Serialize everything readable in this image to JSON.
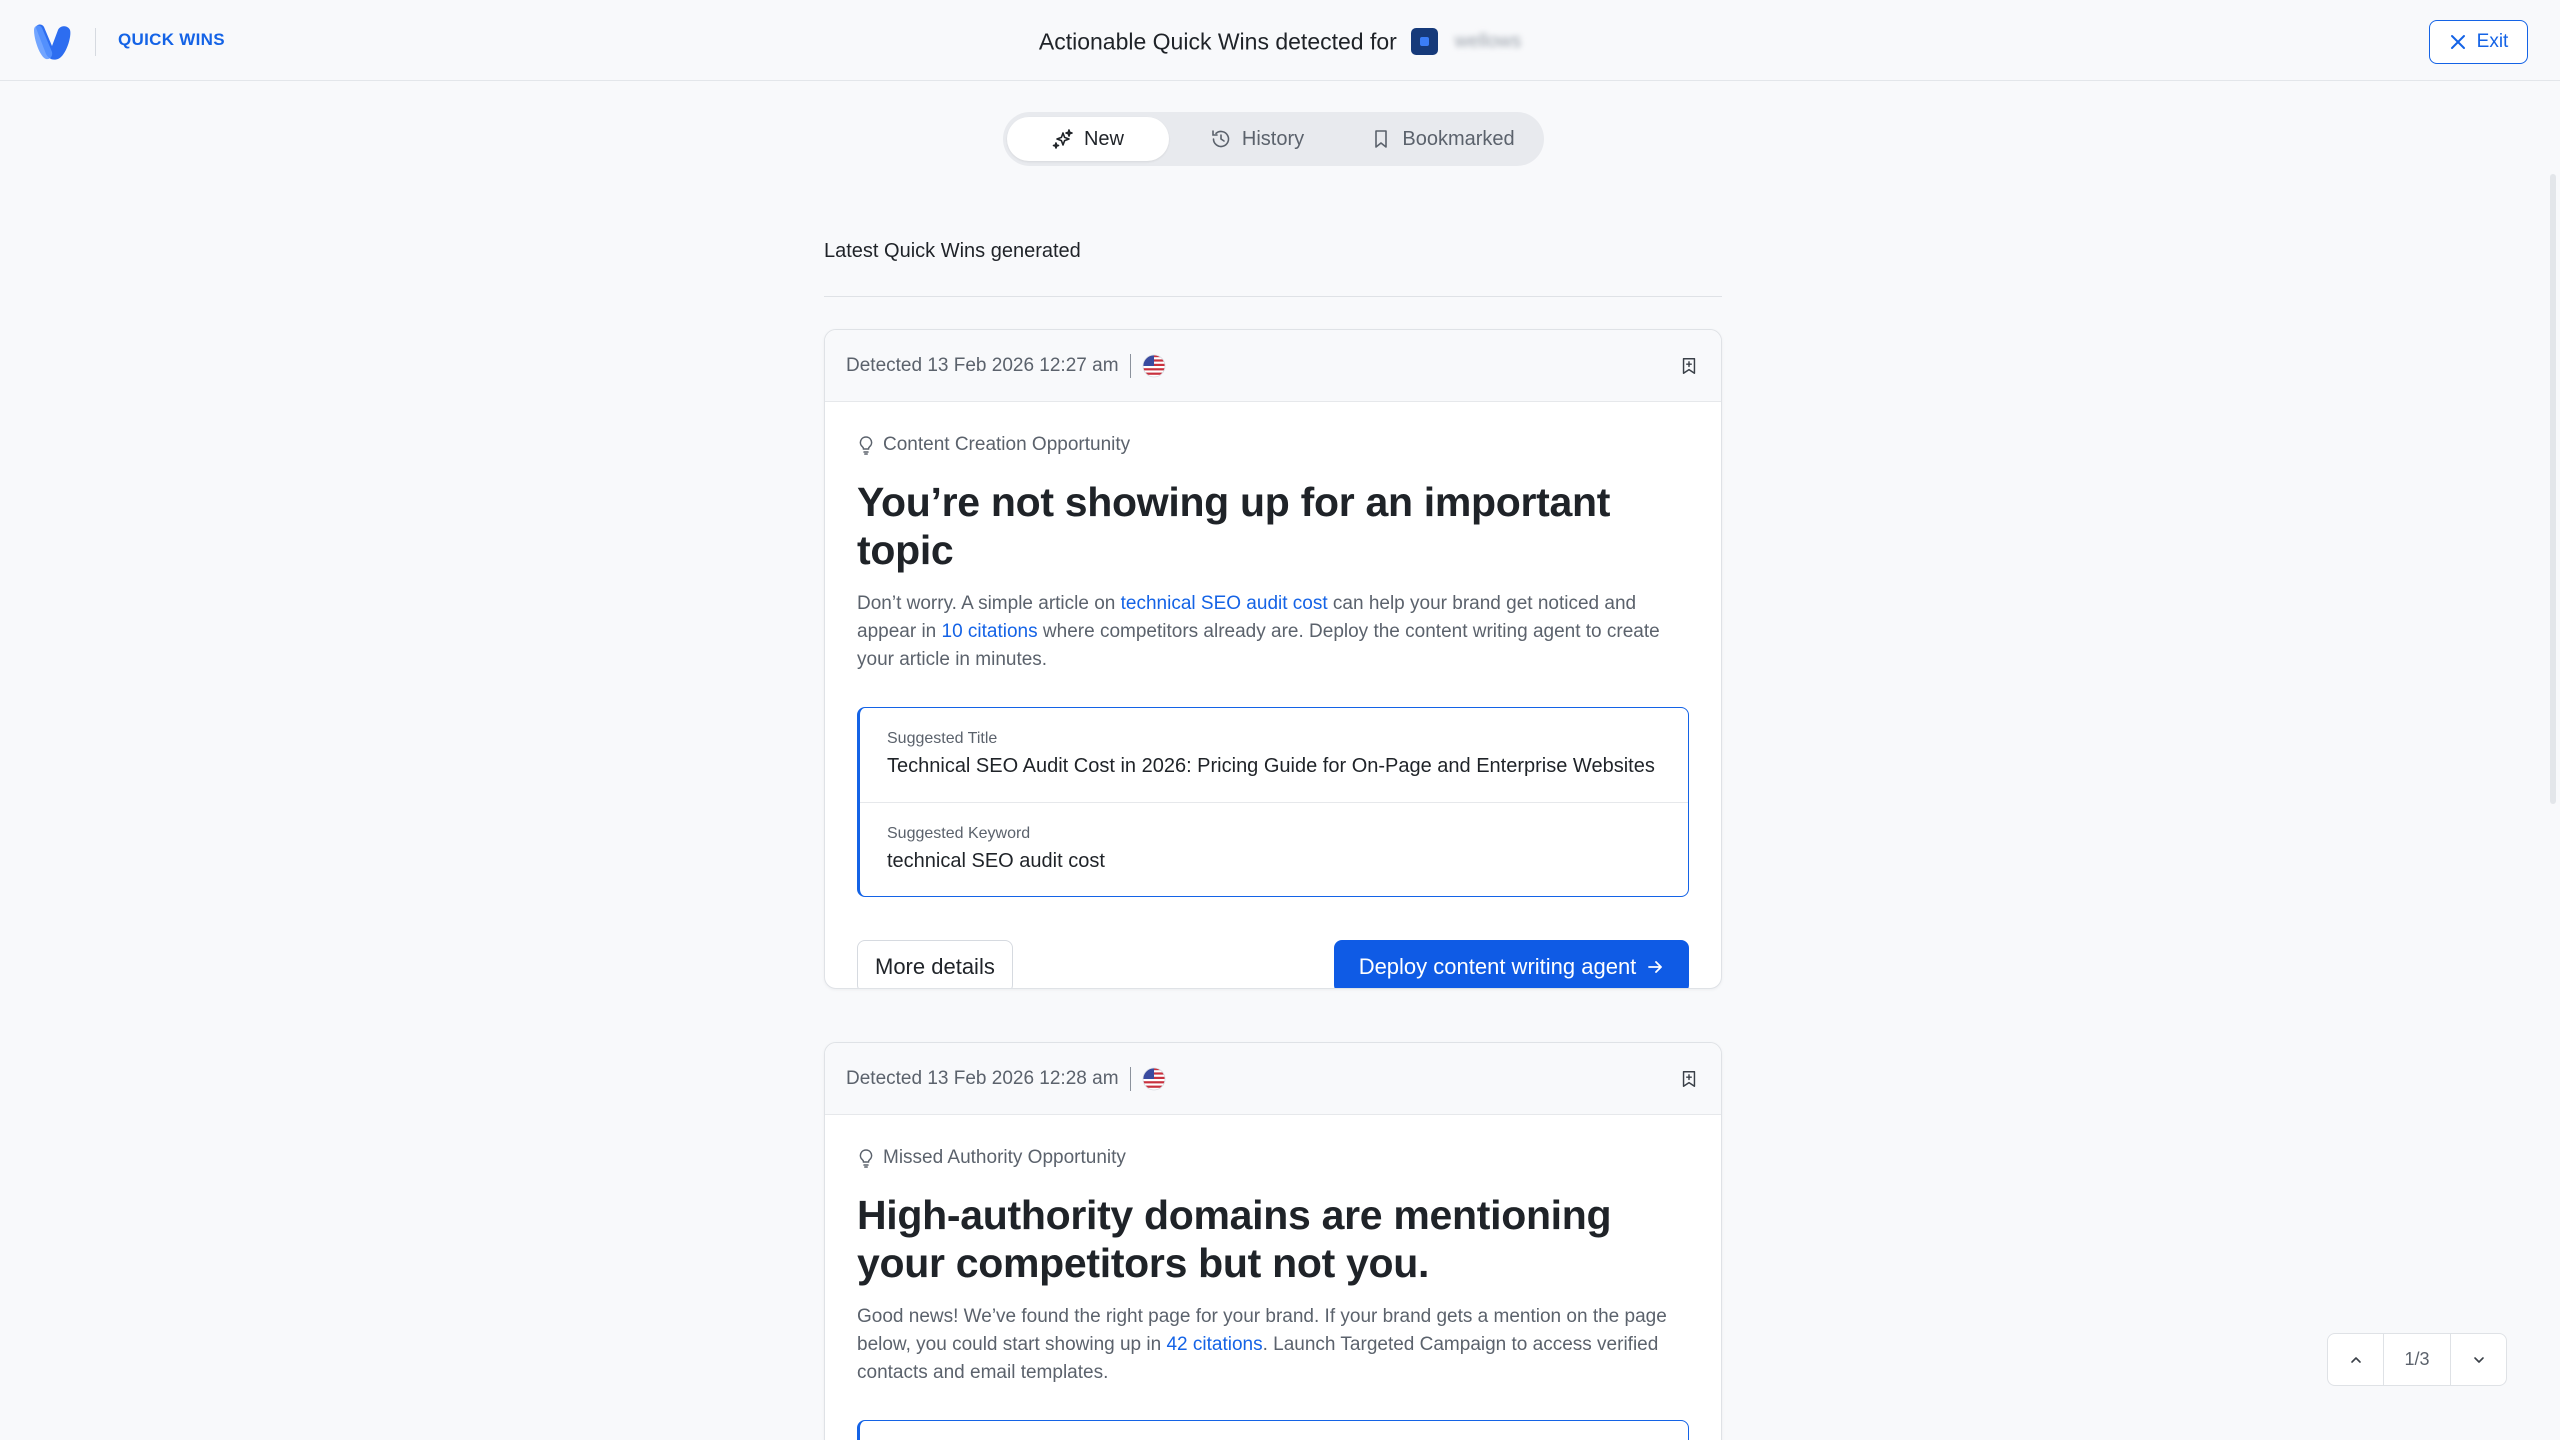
{
  "header": {
    "brand_label": "QUICK WINS",
    "title": "Actionable Quick Wins detected for",
    "site_name": "wellows",
    "exit_label": "Exit"
  },
  "tabs": [
    {
      "label": "New",
      "icon": "sparkles-icon",
      "active": true
    },
    {
      "label": "History",
      "icon": "history-icon",
      "active": false
    },
    {
      "label": "Bookmarked",
      "icon": "bookmark-icon",
      "active": false
    }
  ],
  "section_label": "Latest Quick Wins generated",
  "cards": [
    {
      "detected": "Detected 13 Feb 2026 12:27 am",
      "category": "Content Creation Opportunity",
      "title": "You’re not showing up for an important topic",
      "desc_1": "Don’t worry. A simple article on ",
      "desc_hl_1": "technical SEO audit cost",
      "desc_2": " can help your brand get noticed and appear in ",
      "desc_hl_2": "10 citations",
      "desc_3": " where competitors already are. Deploy the content writing agent to create your article in minutes.",
      "suggested_title_label": "Suggested Title",
      "suggested_title": "Technical SEO Audit Cost in 2026: Pricing Guide for On-Page and Enterprise Websites",
      "suggested_keyword_label": "Suggested Keyword",
      "suggested_keyword": "technical SEO audit cost",
      "more_details_label": "More details",
      "deploy_label": "Deploy content writing agent"
    },
    {
      "detected": "Detected 13 Feb 2026 12:28 am",
      "category": "Missed Authority Opportunity",
      "title": "High-authority domains are mentioning your competitors but not you.",
      "desc_1": "Good news! We’ve found the right page for your brand. If your brand gets a mention on the page below, you could start showing up in ",
      "desc_hl_1": "42 citations",
      "desc_2": ". Launch Targeted Campaign to access verified contacts and email templates."
    }
  ],
  "pager": {
    "count": "1/3"
  },
  "colors": {
    "accent": "#1463e6",
    "primary_button": "#0f5be5",
    "background": "#f8f9fb"
  }
}
